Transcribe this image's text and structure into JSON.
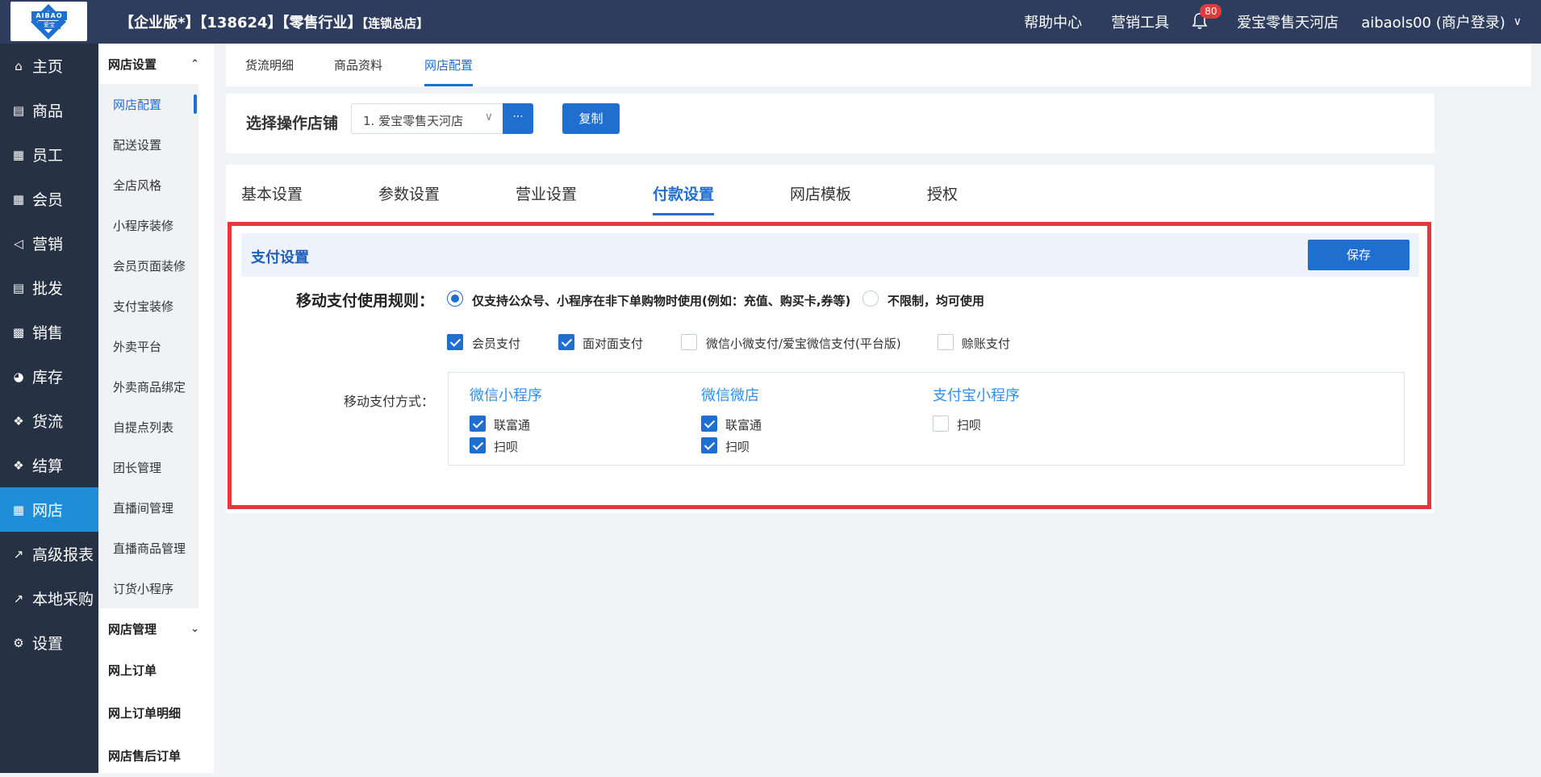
{
  "header": {
    "logo_text": "AIBAO",
    "logo_sub": "爱宝",
    "title_main": "【企业版*】【138624】【零售行业】",
    "title_small": "【连锁总店】",
    "help": "帮助中心",
    "marketing": "营销工具",
    "notification_count": "80",
    "store_name": "爱宝零售天河店",
    "user": "aibaols00 (商户登录)",
    "icons": {
      "bell": "bell-icon",
      "chevron": "chevron-down-icon"
    }
  },
  "nav": {
    "items": [
      {
        "label": "主页",
        "icon": "home-icon"
      },
      {
        "label": "商品",
        "icon": "goods-icon"
      },
      {
        "label": "员工",
        "icon": "staff-icon"
      },
      {
        "label": "会员",
        "icon": "member-icon"
      },
      {
        "label": "营销",
        "icon": "megaphone-icon"
      },
      {
        "label": "批发",
        "icon": "list-icon"
      },
      {
        "label": "销售",
        "icon": "bar-chart-icon"
      },
      {
        "label": "库存",
        "icon": "pie-chart-icon"
      },
      {
        "label": "货流",
        "icon": "cube-icon"
      },
      {
        "label": "结算",
        "icon": "settle-icon"
      },
      {
        "label": "网店",
        "icon": "gift-icon"
      },
      {
        "label": "高级报表",
        "icon": "line-chart-icon"
      },
      {
        "label": "本地采购",
        "icon": "line-chart-icon"
      },
      {
        "label": "设置",
        "icon": "gear-icon"
      }
    ],
    "active_index": 10
  },
  "subnav": {
    "group1": "网店设置",
    "items": [
      "网店配置",
      "配送设置",
      "全店风格",
      "小程序装修",
      "会员页面装修",
      "支付宝装修",
      "外卖平台",
      "外卖商品绑定",
      "自提点列表",
      "团长管理",
      "直播间管理",
      "直播商品管理",
      "订货小程序"
    ],
    "group2": "网店管理",
    "plain": [
      "网上订单",
      "网上订单明细",
      "网店售后订单"
    ]
  },
  "top_tabs": [
    "货流明细",
    "商品资料",
    "网店配置"
  ],
  "store": {
    "label": "选择操作店铺",
    "selected": "1. 爱宝零售天河店",
    "more": "···",
    "copy": "复制"
  },
  "main_tabs": [
    "基本设置",
    "参数设置",
    "营业设置",
    "付款设置",
    "网店模板",
    "授权"
  ],
  "pay": {
    "title": "支付设置",
    "save": "保存",
    "rule_label": "移动支付使用规则：",
    "rule_option1": "仅支持公众号、小程序在非下单购物时使用(例如：充值、购买卡,券等)",
    "rule_option2": "不限制，均可使用",
    "rule_selected": 1,
    "checks": [
      {
        "label": "会员支付",
        "checked": true
      },
      {
        "label": "面对面支付",
        "checked": true
      },
      {
        "label": "微信小微支付/爱宝微信支付(平台版)",
        "checked": false
      },
      {
        "label": "赊账支付",
        "checked": false
      }
    ],
    "method_label": "移动支付方式：",
    "columns": [
      {
        "title": "微信小程序",
        "options": [
          {
            "label": "联富通",
            "checked": true
          },
          {
            "label": "扫呗",
            "checked": true
          }
        ]
      },
      {
        "title": "微信微店",
        "options": [
          {
            "label": "联富通",
            "checked": true
          },
          {
            "label": "扫呗",
            "checked": true
          }
        ]
      },
      {
        "title": "支付宝小程序",
        "options": [
          {
            "label": "扫呗",
            "checked": false
          }
        ]
      }
    ]
  },
  "colors": {
    "topbar": "#2e3d5d",
    "nav": "#263143",
    "accent": "#1e6fd0",
    "highlight": "#e8363b"
  }
}
